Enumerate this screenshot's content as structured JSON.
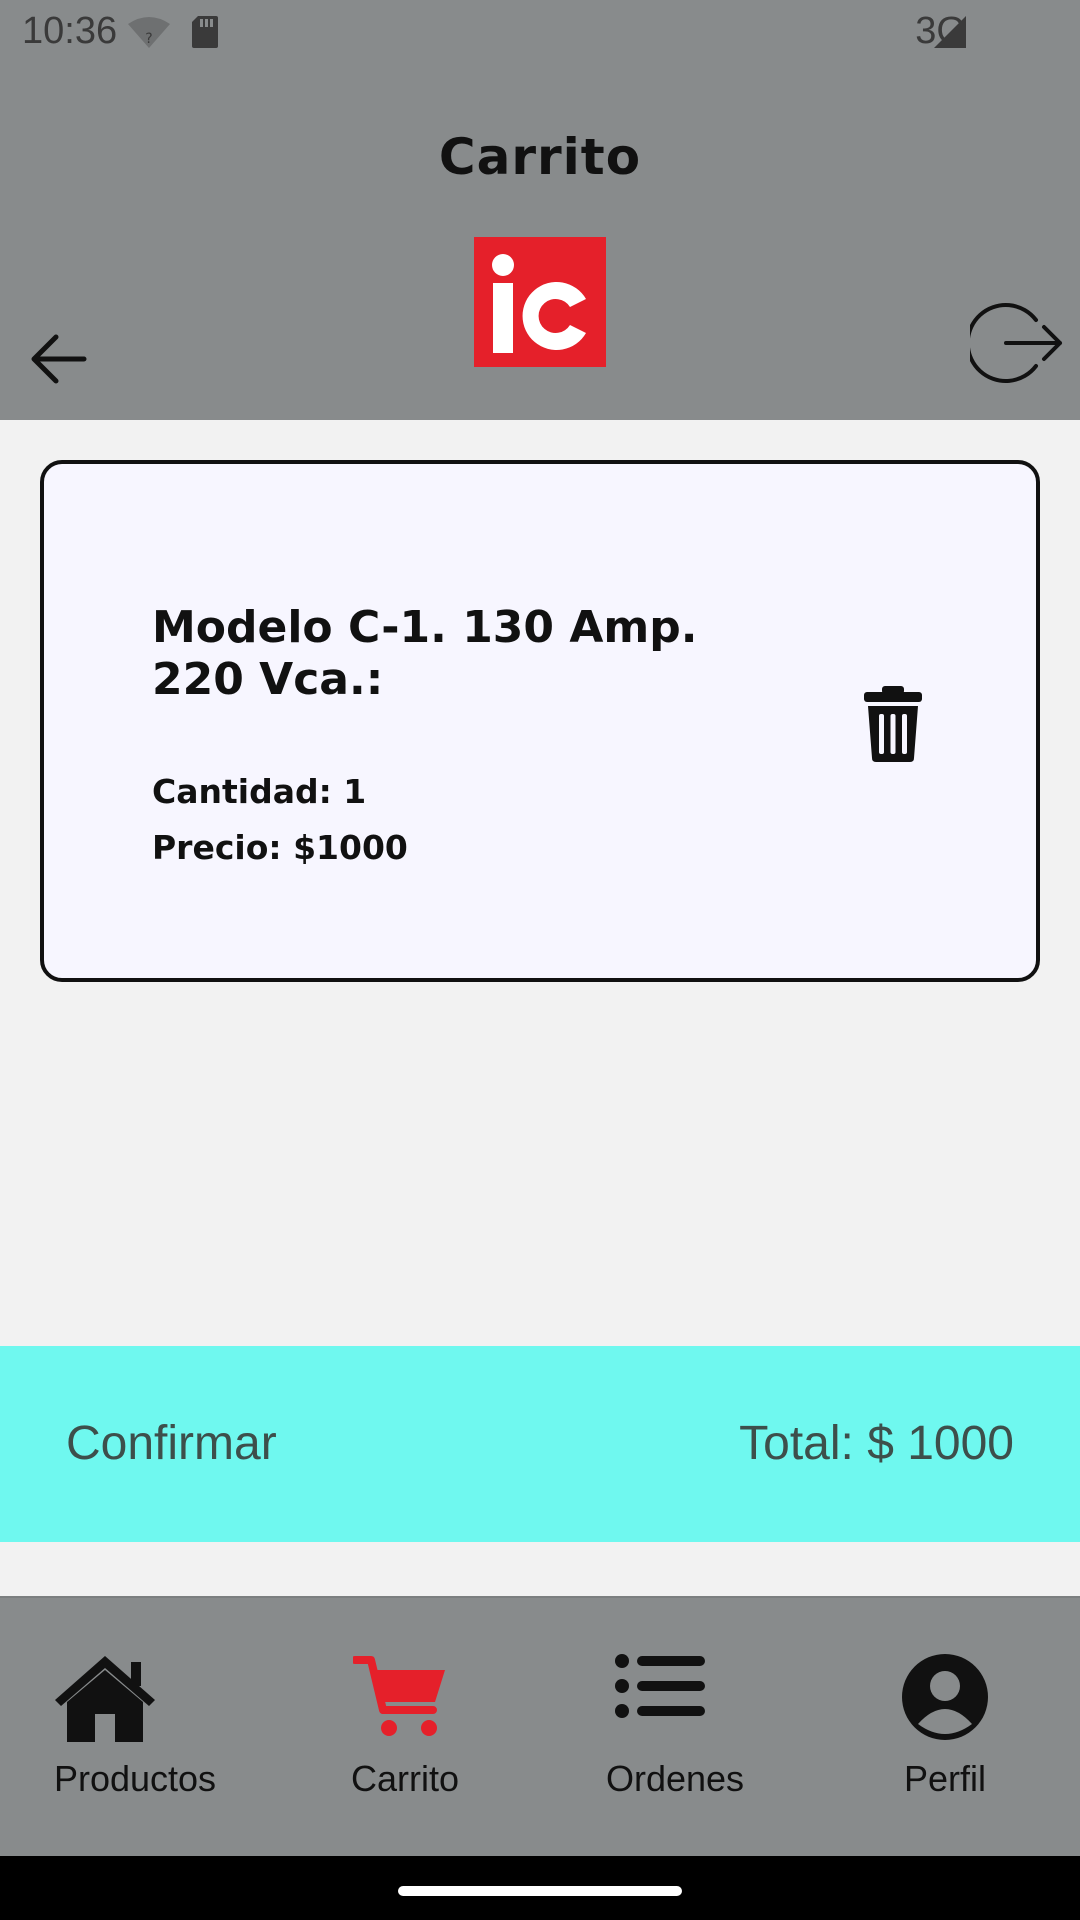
{
  "status_bar": {
    "time": "10:36",
    "network": "3G"
  },
  "header": {
    "title": "Carrito",
    "logo_text": "iC",
    "logo_color": "#e5202a"
  },
  "cart": {
    "items": [
      {
        "name": "Modelo C-1. 130 Amp.\n220 Vca.:",
        "quantity": "Cantidad: 1",
        "price": "Precio: $1000"
      }
    ]
  },
  "footer": {
    "confirm_label": "Confirmar",
    "total": "Total: $ 1000",
    "bar_color": "#6ff8ef"
  },
  "nav": {
    "items": [
      {
        "label": "Productos",
        "icon": "home-icon",
        "active": false
      },
      {
        "label": "Carrito",
        "icon": "cart-icon",
        "active": true
      },
      {
        "label": "Ordenes",
        "icon": "list-icon",
        "active": false
      },
      {
        "label": "Perfil",
        "icon": "user-icon",
        "active": false
      }
    ],
    "active_color": "#e5202a"
  }
}
